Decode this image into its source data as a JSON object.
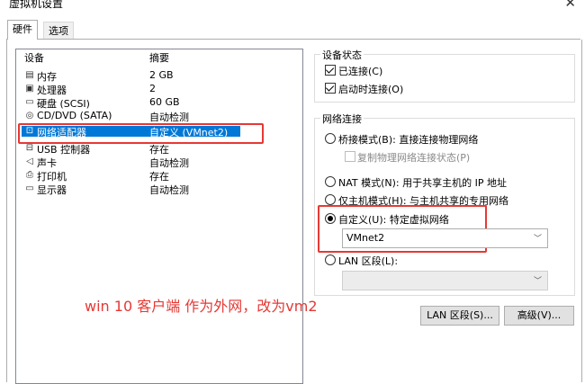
{
  "window": {
    "title": "虚拟机设置",
    "close_glyph": "✕"
  },
  "tabs": [
    {
      "label": "硬件",
      "active": true
    },
    {
      "label": "选项",
      "active": false
    }
  ],
  "device_list": {
    "headers": {
      "device": "设备",
      "summary": "摘要"
    },
    "items": [
      {
        "icon": "memory-icon",
        "glyph": "▤",
        "name": "内存",
        "summary": "2 GB"
      },
      {
        "icon": "processor-icon",
        "glyph": "▣",
        "name": "处理器",
        "summary": "2"
      },
      {
        "icon": "hard-disk-icon",
        "glyph": "▭",
        "name": "硬盘 (SCSI)",
        "summary": "60 GB"
      },
      {
        "icon": "cd-dvd-icon",
        "glyph": "◎",
        "name": "CD/DVD (SATA)",
        "summary": "自动检测"
      },
      {
        "icon": "network-adapter-icon",
        "glyph": "⊡",
        "name": "网络适配器",
        "summary": "自定义 (VMnet2)",
        "selected": true
      },
      {
        "icon": "usb-icon",
        "glyph": "⊟",
        "name": "USB 控制器",
        "summary": "存在"
      },
      {
        "icon": "sound-card-icon",
        "glyph": "◁",
        "name": "声卡",
        "summary": "自动检测"
      },
      {
        "icon": "printer-icon",
        "glyph": "⎙",
        "name": "打印机",
        "summary": "存在"
      },
      {
        "icon": "display-icon",
        "glyph": "▭",
        "name": "显示器",
        "summary": "自动检测"
      }
    ]
  },
  "device_status": {
    "legend": "设备状态",
    "connected": {
      "label": "已连接(C)",
      "checked": true
    },
    "connect_on_power": {
      "label": "启动时连接(O)",
      "checked": true
    }
  },
  "network_connection": {
    "legend": "网络连接",
    "bridged": {
      "label": "桥接模式(B): 直接连接物理网络",
      "selected": false
    },
    "replicate": {
      "label": "复制物理网络连接状态(P)",
      "checked": false,
      "disabled": true
    },
    "nat": {
      "label": "NAT 模式(N): 用于共享主机的 IP 地址",
      "selected": false
    },
    "host_only": {
      "label": "仅主机模式(H): 与主机共享的专用网络",
      "selected": false
    },
    "custom": {
      "label": "自定义(U): 特定虚拟网络",
      "selected": true
    },
    "custom_value": "VMnet2",
    "lan": {
      "label": "LAN 区段(L):",
      "selected": false
    },
    "lan_value": ""
  },
  "buttons": {
    "lan_segments": "LAN 区段(S)...",
    "advanced": "高级(V)..."
  },
  "annotation": "win 10 客户端 作为外网，改为vm2",
  "colors": {
    "selection": "#0078d7",
    "highlight_box": "#e53935",
    "annotation": "#e53935"
  }
}
